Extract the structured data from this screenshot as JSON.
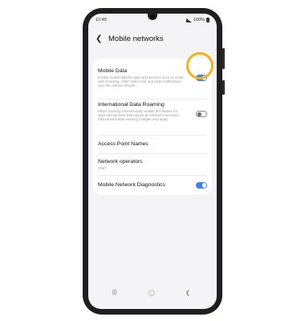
{
  "status_bar": {
    "time": "12:45",
    "battery": "100%"
  },
  "header": {
    "title": "Mobile networks"
  },
  "settings": [
    {
      "title": "Mobile Data",
      "desc": "Enable mobile data for apps and services such as email, web browsing, AT&T Video Call, and push notifications over the cellular network.",
      "toggle": "on"
    },
    {
      "title": "International Data Roaming",
      "desc": "When roaming internationally, enable this feature for apps and services that require an internet connection. International data roaming charges may apply.",
      "toggle": "off"
    },
    {
      "title": "Access Point Names"
    },
    {
      "title": "Network operators",
      "desc": "AT&T"
    },
    {
      "title": "Mobile Network Diagnostics",
      "toggle": "on"
    }
  ],
  "colors": {
    "accent": "#3d82f6",
    "highlight": "#f3b21b"
  },
  "icons": {
    "back": "chevron-left-icon",
    "recents": "recents-icon",
    "home": "home-icon",
    "back_nav": "back-nav-icon"
  }
}
